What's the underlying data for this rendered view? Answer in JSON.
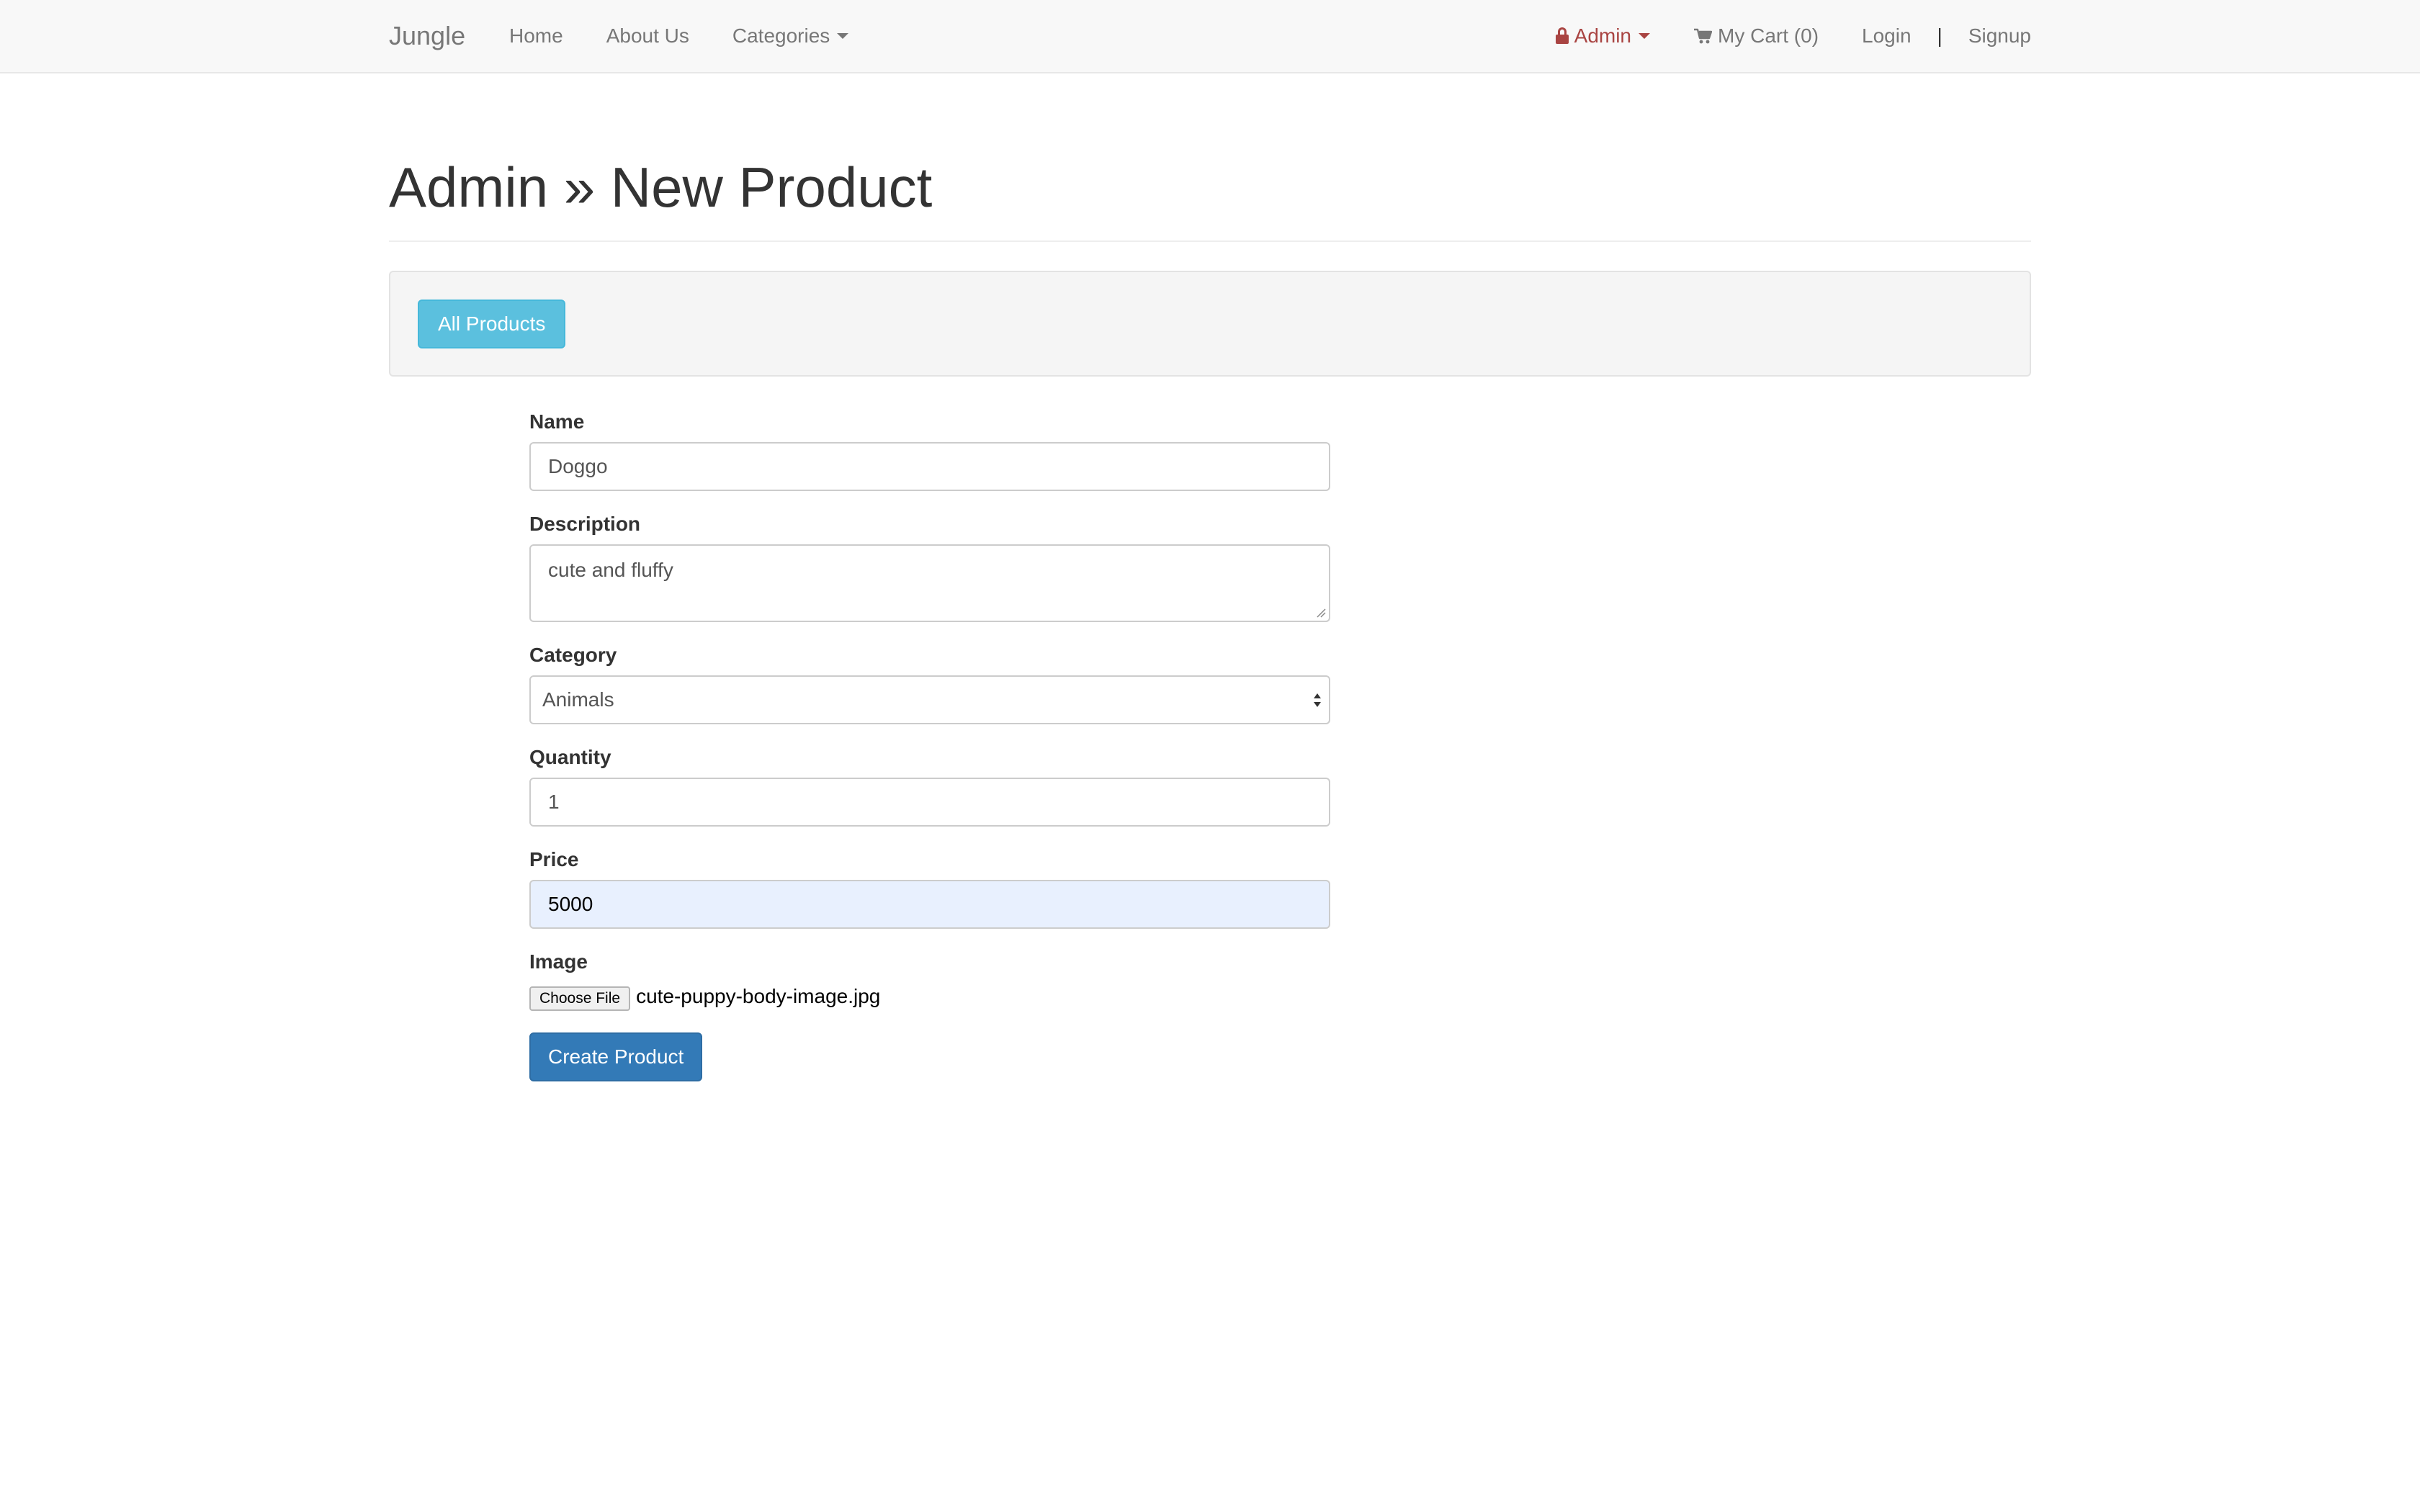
{
  "navbar": {
    "brand": "Jungle",
    "left_links": [
      {
        "label": "Home"
      },
      {
        "label": "About Us"
      },
      {
        "label": "Categories"
      }
    ],
    "admin_label": "Admin",
    "cart_label": "My Cart (0)",
    "login_label": "Login",
    "separator": "|",
    "signup_label": "Signup"
  },
  "page": {
    "title": "Admin » New Product",
    "all_products_button": "All Products"
  },
  "form": {
    "name": {
      "label": "Name",
      "value": "Doggo"
    },
    "description": {
      "label": "Description",
      "value": "cute and fluffy"
    },
    "category": {
      "label": "Category",
      "selected": "Animals"
    },
    "quantity": {
      "label": "Quantity",
      "value": "1"
    },
    "price": {
      "label": "Price",
      "value": "5000"
    },
    "image": {
      "label": "Image",
      "choose_button": "Choose File",
      "file_name": "cute-puppy-body-image.jpg"
    },
    "submit_label": "Create Product"
  },
  "colors": {
    "admin_accent": "#a94442",
    "info_button": "#5bc0de",
    "primary_button": "#337ab7",
    "autofill_background": "#e8f0fe"
  },
  "icons": [
    "lock-icon",
    "cart-icon",
    "caret-down-icon",
    "select-arrows-icon",
    "resize-grip-icon"
  ]
}
